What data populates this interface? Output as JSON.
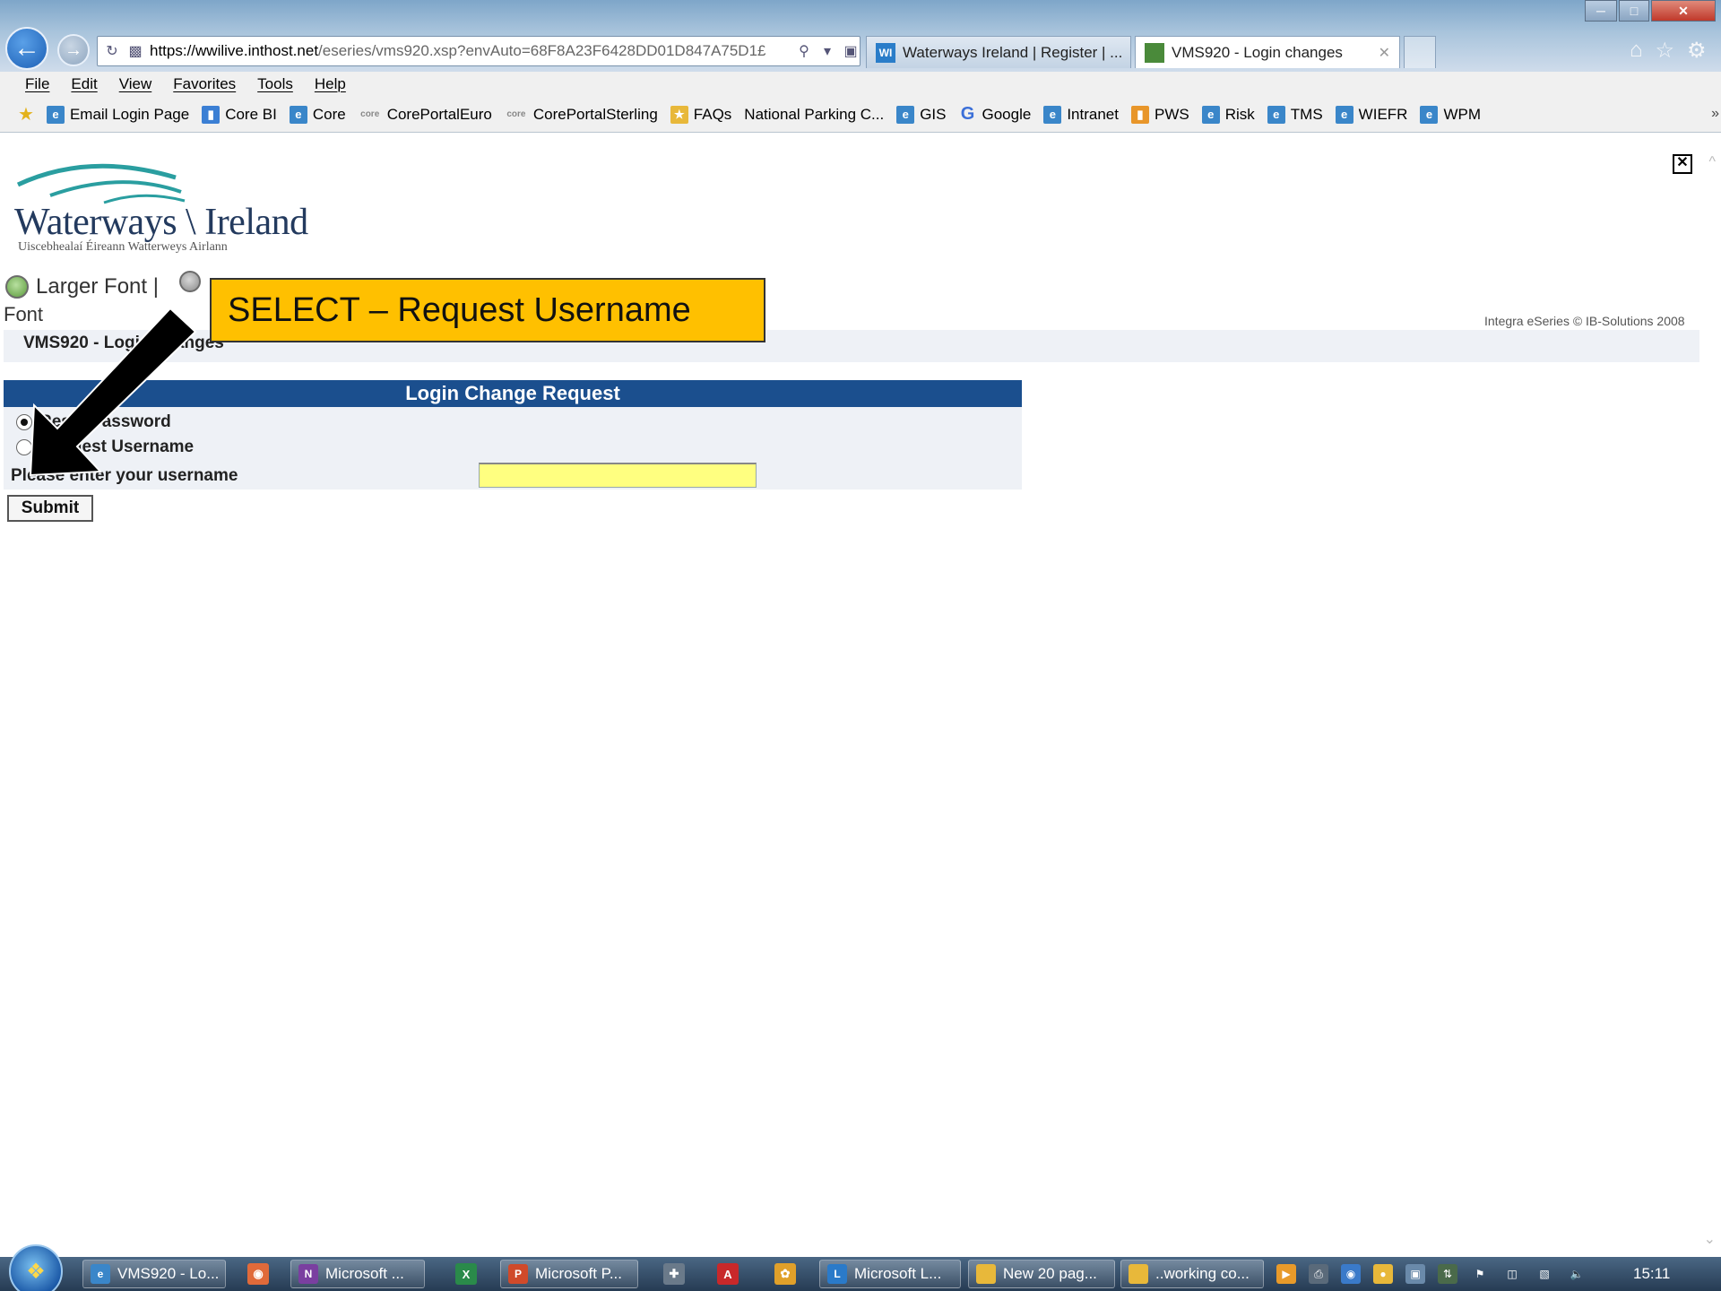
{
  "browser": {
    "url_prefix": "https://",
    "url_host": "wwilive.inthost.net",
    "url_path": "/eseries/vms920.xsp?envAuto=68F8A23F6428DD01D847A75D1£",
    "tabs": [
      {
        "label": "Waterways Ireland | Register | ...",
        "favicon": "WI"
      },
      {
        "label": "VMS920 - Login changes",
        "favicon": ""
      }
    ]
  },
  "menu": [
    "File",
    "Edit",
    "View",
    "Favorites",
    "Tools",
    "Help"
  ],
  "favorites": [
    {
      "label": "Email Login Page",
      "icon": "ie-page-icon"
    },
    {
      "label": "Core BI",
      "icon": "bar-chart-icon"
    },
    {
      "label": "Core",
      "icon": "ie-page-icon"
    },
    {
      "label": "CorePortalEuro",
      "icon": "core-icon"
    },
    {
      "label": "CorePortalSterling",
      "icon": "core-icon"
    },
    {
      "label": "FAQs",
      "icon": "faq-icon"
    },
    {
      "label": "National Parking C...",
      "icon": "none"
    },
    {
      "label": "GIS",
      "icon": "ie-page-icon"
    },
    {
      "label": "Google",
      "icon": "google-icon"
    },
    {
      "label": "Intranet",
      "icon": "ie-page-icon"
    },
    {
      "label": "PWS",
      "icon": "pws-icon"
    },
    {
      "label": "Risk",
      "icon": "ie-page-icon"
    },
    {
      "label": "TMS",
      "icon": "ie-page-icon"
    },
    {
      "label": "WIEFR",
      "icon": "ie-page-icon"
    },
    {
      "label": "WPM",
      "icon": "ie-page-icon"
    }
  ],
  "page": {
    "logo_name": "Waterways \\ Ireland",
    "logo_sub": "Uiscebhealaí Éireann   Watterweys Airlann",
    "larger_font": "Larger Font |",
    "font_text": "Font",
    "integra": "Integra eSeries © IB-Solutions 2008",
    "title": "VMS920 - Login changes",
    "form_header": "Login Change Request",
    "options": [
      {
        "label": "Reset Password",
        "checked": true
      },
      {
        "label": "Request Username",
        "checked": false
      }
    ],
    "prompt": "Please enter your username",
    "username_value": "",
    "submit": "Submit"
  },
  "annotation": {
    "callout_text": "SELECT – Request Username",
    "callout_color": "#ffc000"
  },
  "taskbar": {
    "buttons": [
      {
        "label": "VMS920 - Lo...",
        "icon": "ie-icon"
      },
      {
        "label": "Microsoft ...",
        "icon": "onenote-icon"
      },
      {
        "label": "Microsoft P...",
        "icon": "powerpoint-icon"
      },
      {
        "label": "Microsoft L...",
        "icon": "lync-icon"
      },
      {
        "label": "New 20 pag...",
        "icon": "folder-icon"
      },
      {
        "label": "..working co...",
        "icon": "folder-icon"
      }
    ],
    "clock": "15:11"
  },
  "colors": {
    "form_header_bg": "#1b4f8e",
    "input_bg": "#ffff80",
    "panel_bg": "#eef1f6"
  }
}
